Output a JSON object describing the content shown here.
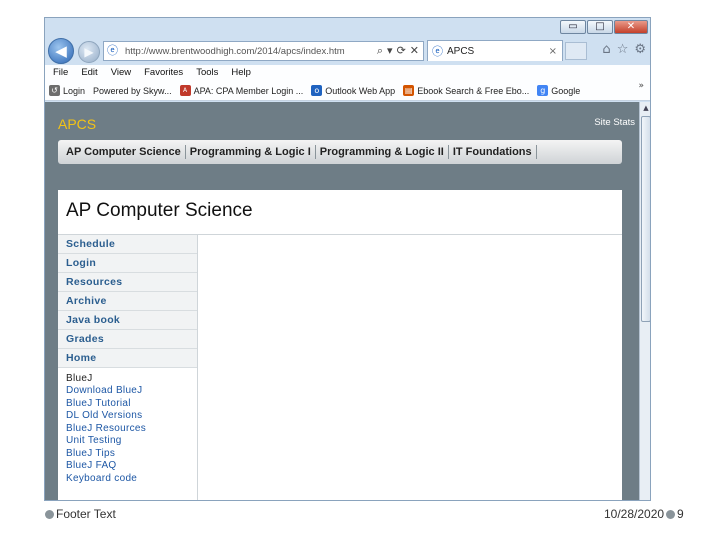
{
  "browser": {
    "window_buttons": [
      "▭",
      "□",
      "✕"
    ],
    "address_url": "http://www.brentwoodhigh.com/2014/apcs/index.htm",
    "address_tools": [
      "⌕",
      "▾",
      "⟳",
      "✕"
    ],
    "tab_title": "APCS",
    "tab_close": "×",
    "toolbar_icons": [
      "⌂",
      "☆",
      "⚙"
    ],
    "menu": [
      "File",
      "Edit",
      "View",
      "Favorites",
      "Tools",
      "Help"
    ],
    "favorites": [
      {
        "label": "Login",
        "icon_color": "#6d6d6d"
      },
      {
        "label": "Powered by Skyw...",
        "icon_color": "#ffffff"
      },
      {
        "label": "APA: CPA Member Login ...",
        "icon_color": "#c0392b"
      },
      {
        "label": "Outlook Web App",
        "icon_color": "#1f63c0"
      },
      {
        "label": "Ebook Search & Free Ebo...",
        "icon_color": "#d35400"
      },
      {
        "label": "Google",
        "icon_color": "#4285f4"
      }
    ],
    "favorites_more": "»"
  },
  "site": {
    "title": "APCS",
    "stats_link": "Site Stats",
    "nav": [
      "AP Computer Science",
      "Programming & Logic I",
      "Programming & Logic II",
      "IT Foundations"
    ],
    "page_heading": "AP Computer Science",
    "sidebar_links": [
      "Schedule",
      "Login",
      "Resources",
      "Archive",
      "Java book",
      "Grades",
      "Home"
    ],
    "sidebar_section_title": "BlueJ",
    "sidebar_sublinks": [
      "Download BlueJ",
      "BlueJ Tutorial",
      "DL Old Versions",
      "BlueJ Resources",
      "Unit Testing",
      "BlueJ Tips",
      "BlueJ FAQ",
      "Keyboard code"
    ]
  },
  "footer": {
    "left_text": "Footer Text",
    "date": "10/28/2020",
    "page_number": "9"
  },
  "colors": {
    "site_title": "#f3c316",
    "site_background": "#6e7d86",
    "link": "#1d57a5"
  }
}
